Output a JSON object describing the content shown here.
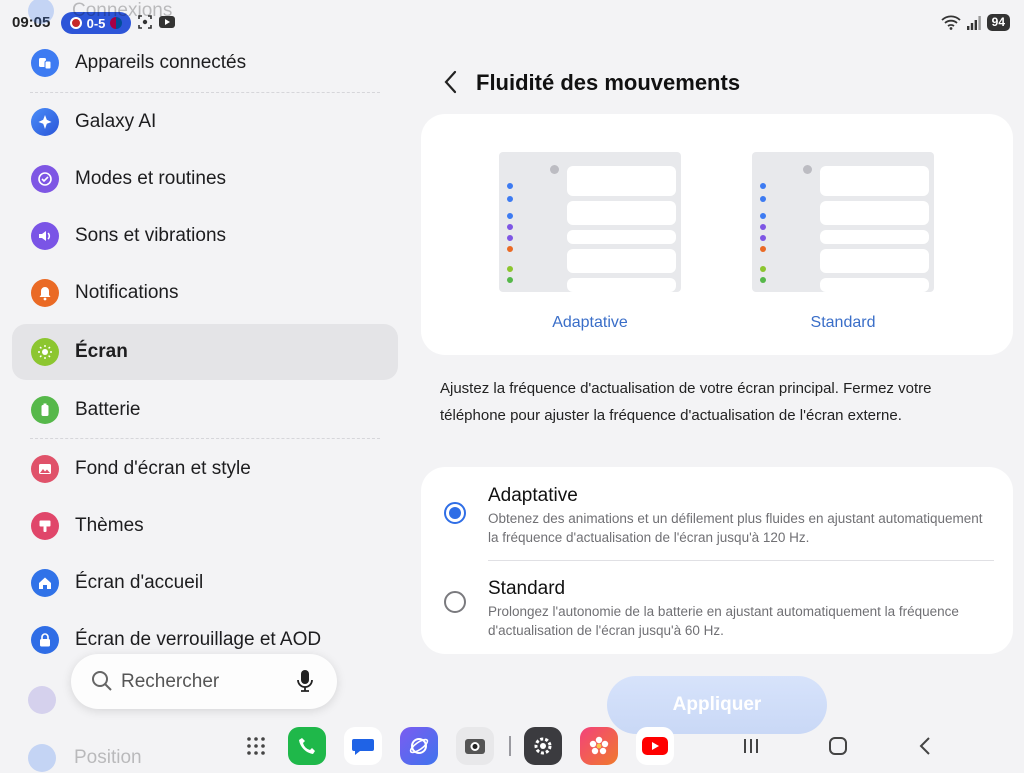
{
  "status_bar": {
    "time": "09:05",
    "score": "0-5",
    "battery": "94"
  },
  "settings": {
    "faded_top": "Connexions",
    "items": [
      {
        "label": "Appareils connectés",
        "icon": "connected-devices-icon",
        "color": "#3d7bf2"
      },
      {
        "label": "Galaxy AI",
        "icon": "galaxy-ai-icon",
        "color": "#2e66e8"
      },
      {
        "label": "Modes et routines",
        "icon": "modes-routines-icon",
        "color": "#7e56e4"
      },
      {
        "label": "Sons et vibrations",
        "icon": "sound-icon",
        "color": "#7a54e6"
      },
      {
        "label": "Notifications",
        "icon": "bell-icon",
        "color": "#ea6a25"
      },
      {
        "label": "Écran",
        "icon": "sun-icon",
        "color": "#8cc630"
      },
      {
        "label": "Batterie",
        "icon": "battery-icon",
        "color": "#56b84a"
      },
      {
        "label": "Fond d'écran et style",
        "icon": "wallpaper-icon",
        "color": "#e0526a"
      },
      {
        "label": "Thèmes",
        "icon": "themes-icon",
        "color": "#e0466a"
      },
      {
        "label": "Écran d'accueil",
        "icon": "home-icon",
        "color": "#3072e8"
      },
      {
        "label": "Écran de verrouillage et AOD",
        "icon": "lock-icon",
        "color": "#2f6de6"
      }
    ],
    "faded_bottom": "Position"
  },
  "search": {
    "placeholder": "Rechercher"
  },
  "panel": {
    "title": "Fluidité des mouvements",
    "previews": [
      {
        "label": "Adaptative"
      },
      {
        "label": "Standard"
      }
    ],
    "description": "Ajustez la fréquence d'actualisation de votre écran principal. Fermez votre téléphone pour ajuster la fréquence d'actualisation de l'écran externe.",
    "options": [
      {
        "title": "Adaptative",
        "desc": "Obtenez des animations et un défilement plus fluides en ajustant automatiquement la fréquence d'actualisation de l'écran jusqu'à 120 Hz.",
        "selected": true
      },
      {
        "title": "Standard",
        "desc": "Prolongez l'autonomie de la batterie en ajustant automatiquement la fréquence d'actualisation de l'écran jusqu'à 60 Hz.",
        "selected": false
      }
    ],
    "apply_label": "Appliquer"
  },
  "taskbar": {
    "apps": [
      "apps-grid-icon",
      "phone-app-icon",
      "messages-app-icon",
      "internet-app-icon",
      "camera-app-icon",
      "settings-app-icon",
      "gallery-app-icon",
      "youtube-app-icon"
    ],
    "nav": [
      "recents-icon",
      "home-nav-icon",
      "back-nav-icon"
    ]
  },
  "colors": {
    "accent": "#2f6ee6",
    "link": "#3a6ec8",
    "background": "#f3f3f5",
    "selected_row": "#e4e4e7"
  }
}
